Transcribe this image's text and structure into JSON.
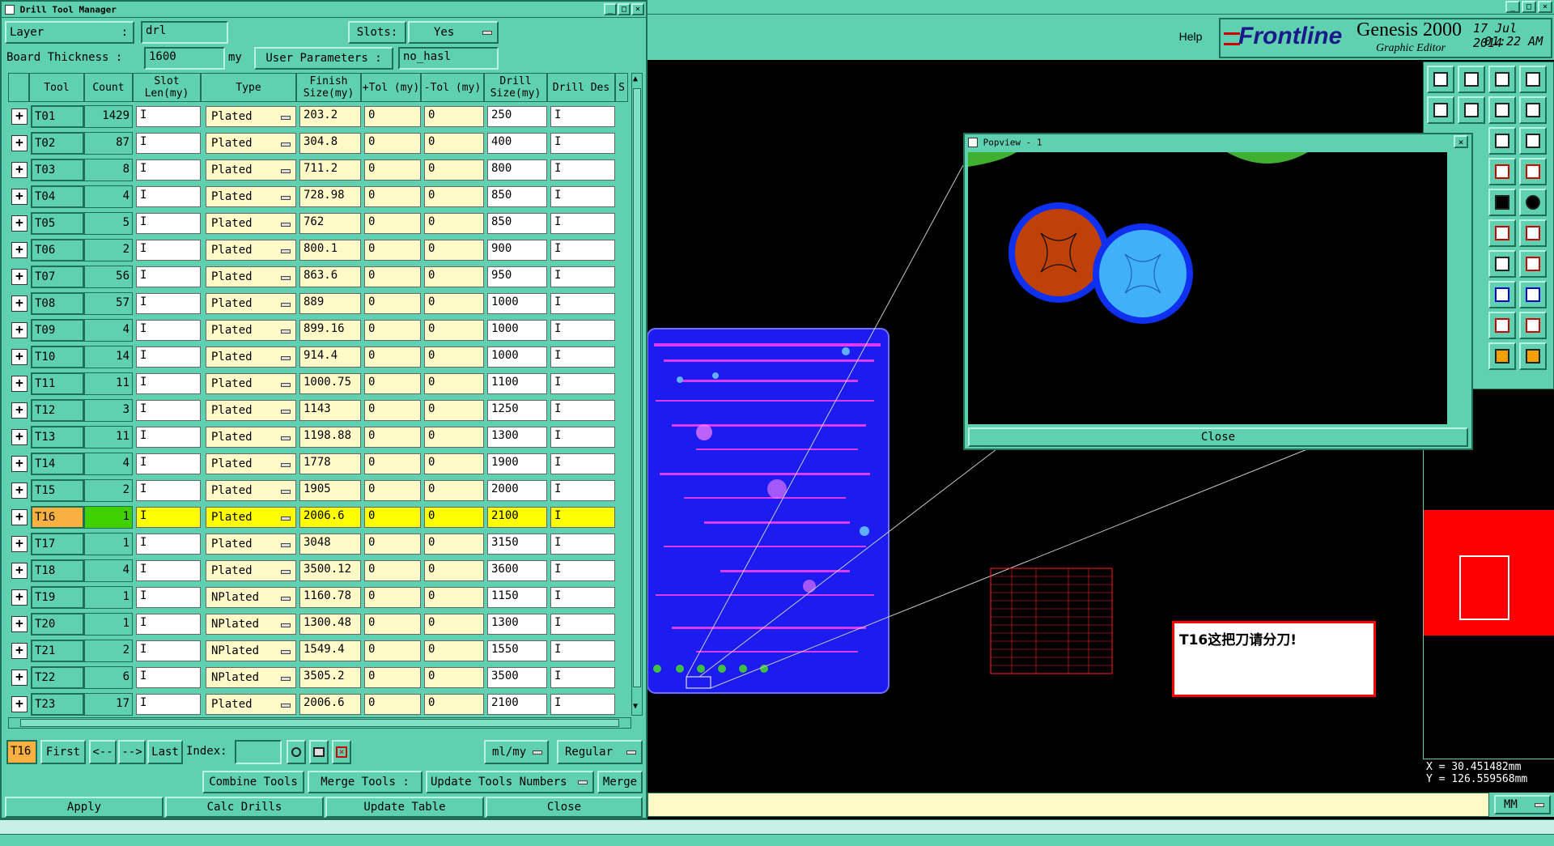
{
  "dialog": {
    "title": "Drill Tool Manager",
    "layer_label": "Layer",
    "layer_value": "drl",
    "slots_label": "Slots:",
    "slots_value": "Yes",
    "board_thickness_label": "Board Thickness :",
    "board_thickness_value": "1600",
    "board_thickness_unit": "my",
    "user_params_label": "User Parameters :",
    "user_params_value": "no_hasl",
    "columns": [
      "Tool",
      "Count",
      "Slot Len(my)",
      "Type",
      "Finish Size(my)",
      "+Tol (my)",
      "-Tol (my)",
      "Drill Size(my)",
      "Drill Des",
      "S"
    ],
    "rows": [
      {
        "tool": "T01",
        "count": "1429",
        "type": "Plated",
        "finish": "203.2",
        "ptol": "0",
        "ntol": "0",
        "drill": "250"
      },
      {
        "tool": "T02",
        "count": "87",
        "type": "Plated",
        "finish": "304.8",
        "ptol": "0",
        "ntol": "0",
        "drill": "400"
      },
      {
        "tool": "T03",
        "count": "8",
        "type": "Plated",
        "finish": "711.2",
        "ptol": "0",
        "ntol": "0",
        "drill": "800"
      },
      {
        "tool": "T04",
        "count": "4",
        "type": "Plated",
        "finish": "728.98",
        "ptol": "0",
        "ntol": "0",
        "drill": "850"
      },
      {
        "tool": "T05",
        "count": "5",
        "type": "Plated",
        "finish": "762",
        "ptol": "0",
        "ntol": "0",
        "drill": "850"
      },
      {
        "tool": "T06",
        "count": "2",
        "type": "Plated",
        "finish": "800.1",
        "ptol": "0",
        "ntol": "0",
        "drill": "900"
      },
      {
        "tool": "T07",
        "count": "56",
        "type": "Plated",
        "finish": "863.6",
        "ptol": "0",
        "ntol": "0",
        "drill": "950"
      },
      {
        "tool": "T08",
        "count": "57",
        "type": "Plated",
        "finish": "889",
        "ptol": "0",
        "ntol": "0",
        "drill": "1000"
      },
      {
        "tool": "T09",
        "count": "4",
        "type": "Plated",
        "finish": "899.16",
        "ptol": "0",
        "ntol": "0",
        "drill": "1000"
      },
      {
        "tool": "T10",
        "count": "14",
        "type": "Plated",
        "finish": "914.4",
        "ptol": "0",
        "ntol": "0",
        "drill": "1000"
      },
      {
        "tool": "T11",
        "count": "11",
        "type": "Plated",
        "finish": "1000.75",
        "ptol": "0",
        "ntol": "0",
        "drill": "1100"
      },
      {
        "tool": "T12",
        "count": "3",
        "type": "Plated",
        "finish": "1143",
        "ptol": "0",
        "ntol": "0",
        "drill": "1250"
      },
      {
        "tool": "T13",
        "count": "11",
        "type": "Plated",
        "finish": "1198.88",
        "ptol": "0",
        "ntol": "0",
        "drill": "1300"
      },
      {
        "tool": "T14",
        "count": "4",
        "type": "Plated",
        "finish": "1778",
        "ptol": "0",
        "ntol": "0",
        "drill": "1900"
      },
      {
        "tool": "T15",
        "count": "2",
        "type": "Plated",
        "finish": "1905",
        "ptol": "0",
        "ntol": "0",
        "drill": "2000"
      },
      {
        "tool": "T16",
        "count": "1",
        "type": "Plated",
        "finish": "2006.6",
        "ptol": "0",
        "ntol": "0",
        "drill": "2100",
        "selected": true
      },
      {
        "tool": "T17",
        "count": "1",
        "type": "Plated",
        "finish": "3048",
        "ptol": "0",
        "ntol": "0",
        "drill": "3150"
      },
      {
        "tool": "T18",
        "count": "4",
        "type": "Plated",
        "finish": "3500.12",
        "ptol": "0",
        "ntol": "0",
        "drill": "3600"
      },
      {
        "tool": "T19",
        "count": "1",
        "type": "NPlated",
        "finish": "1160.78",
        "ptol": "0",
        "ntol": "0",
        "drill": "1150"
      },
      {
        "tool": "T20",
        "count": "1",
        "type": "NPlated",
        "finish": "1300.48",
        "ptol": "0",
        "ntol": "0",
        "drill": "1300"
      },
      {
        "tool": "T21",
        "count": "2",
        "type": "NPlated",
        "finish": "1549.4",
        "ptol": "0",
        "ntol": "0",
        "drill": "1550"
      },
      {
        "tool": "T22",
        "count": "6",
        "type": "NPlated",
        "finish": "3505.2",
        "ptol": "0",
        "ntol": "0",
        "drill": "3500"
      },
      {
        "tool": "T23",
        "count": "17",
        "type": "Plated",
        "finish": "2006.6",
        "ptol": "0",
        "ntol": "0",
        "drill": "2100"
      }
    ],
    "nav": {
      "current": "T16",
      "first": "First",
      "prev": "<--",
      "next": "-->",
      "last": "Last",
      "index_label": "Index:",
      "units": "ml/my",
      "mode": "Regular"
    },
    "actions": {
      "combine": "Combine Tools",
      "merge_label": "Merge Tools :",
      "update_numbers": "Update Tools Numbers",
      "merge": "Merge",
      "apply": "Apply",
      "calc": "Calc Drills",
      "update_table": "Update Table",
      "close": "Close"
    }
  },
  "app": {
    "help": "Help",
    "brand": "Frontline",
    "product": "Genesis 2000",
    "subtitle": "Graphic Editor",
    "date": "17 Jul 2014",
    "time": "01:22 AM",
    "coord_x": "X = 30.451482mm",
    "coord_y": "Y = 126.559568mm",
    "units": "MM"
  },
  "popview": {
    "title": "Popview - 1",
    "close": "Close"
  },
  "annotation": {
    "text": "T16这把刀请分刀!"
  },
  "colors": {
    "teal": "#5fd0b0",
    "board_blue": "#1c1cf0",
    "pad_orange": "#c0400a",
    "pad_cyan": "#40b0f8",
    "ring_blue": "#1030f0",
    "selected_yellow": "#ffff00",
    "brand_red": "#d00000"
  }
}
